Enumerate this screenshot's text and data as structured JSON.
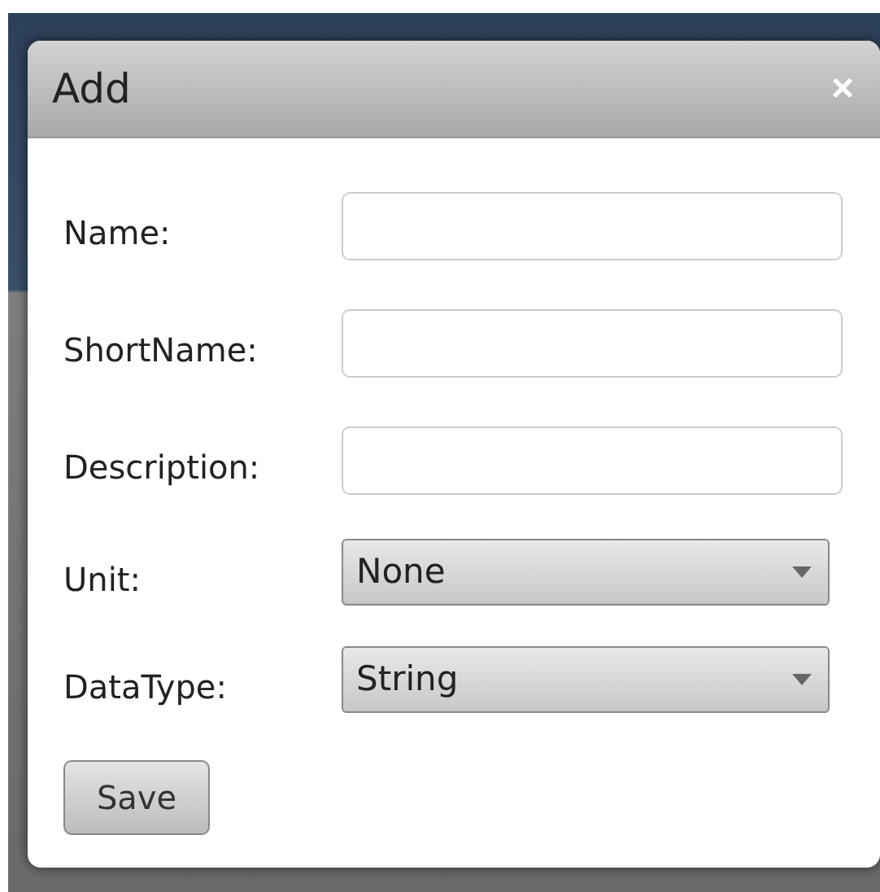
{
  "dialog": {
    "title": "Add",
    "close": "×"
  },
  "fields": [
    {
      "kind": "text",
      "label": "Name:"
    },
    {
      "kind": "text",
      "label": "ShortName:"
    },
    {
      "kind": "text",
      "label": "Description:"
    },
    {
      "kind": "select",
      "label": "Unit:",
      "value": "None"
    },
    {
      "kind": "select",
      "label": "DataType:",
      "value": "String"
    }
  ],
  "buttons": [
    "Save"
  ]
}
